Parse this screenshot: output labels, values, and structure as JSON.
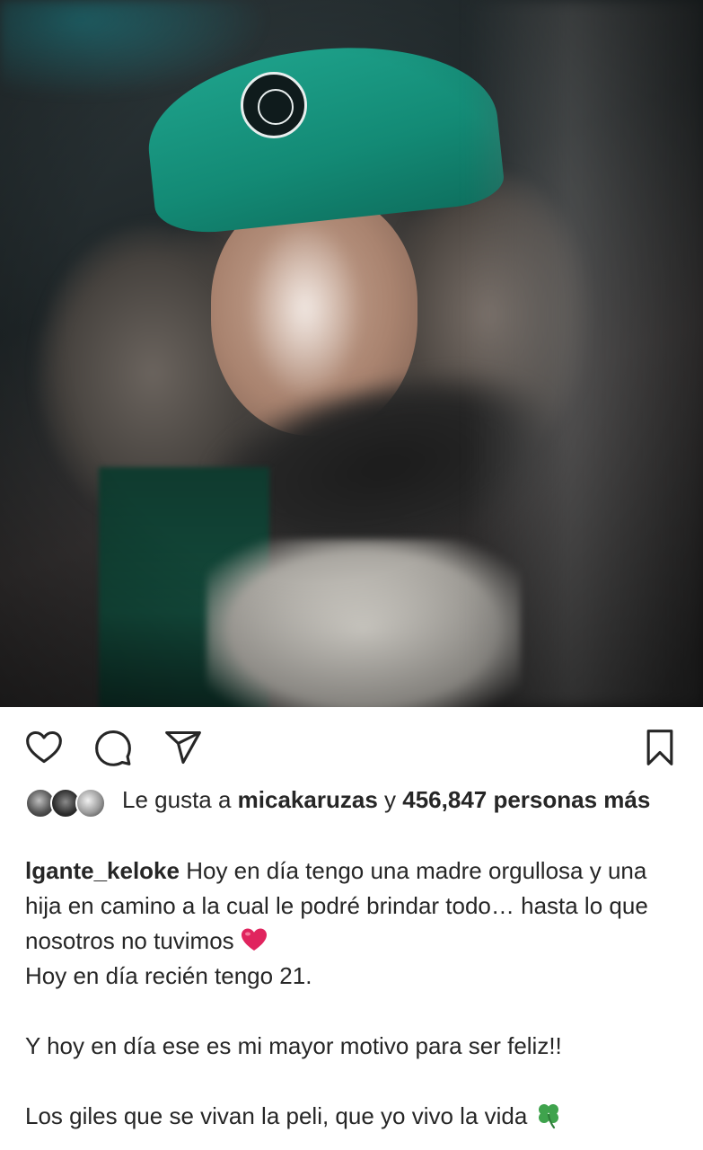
{
  "post": {
    "actions": {
      "like_icon": "heart-outline-icon",
      "comment_icon": "comment-bubble-icon",
      "share_icon": "paper-plane-icon",
      "save_icon": "bookmark-outline-icon"
    },
    "likes": {
      "prefix": "Le gusta a",
      "first_liker": "micakaruzas",
      "joiner": "y",
      "count_text": "456,847 personas más"
    },
    "caption": {
      "username": "lgante_keloke",
      "line1": " Hoy en día tengo una madre orgullosa y una hija en camino a la cual le podré brindar todo… hasta lo que nosotros no tuvimos ",
      "line2": "Hoy en día recién tengo 21.",
      "line3": "Y hoy en día ese es mi mayor motivo para ser feliz!!",
      "line4": "Los giles que se vivan la peli, que yo vivo la vida "
    },
    "colors": {
      "text": "#262626",
      "heart_emoji": "#e0245e",
      "clover_emoji": "#3fa34d"
    }
  }
}
